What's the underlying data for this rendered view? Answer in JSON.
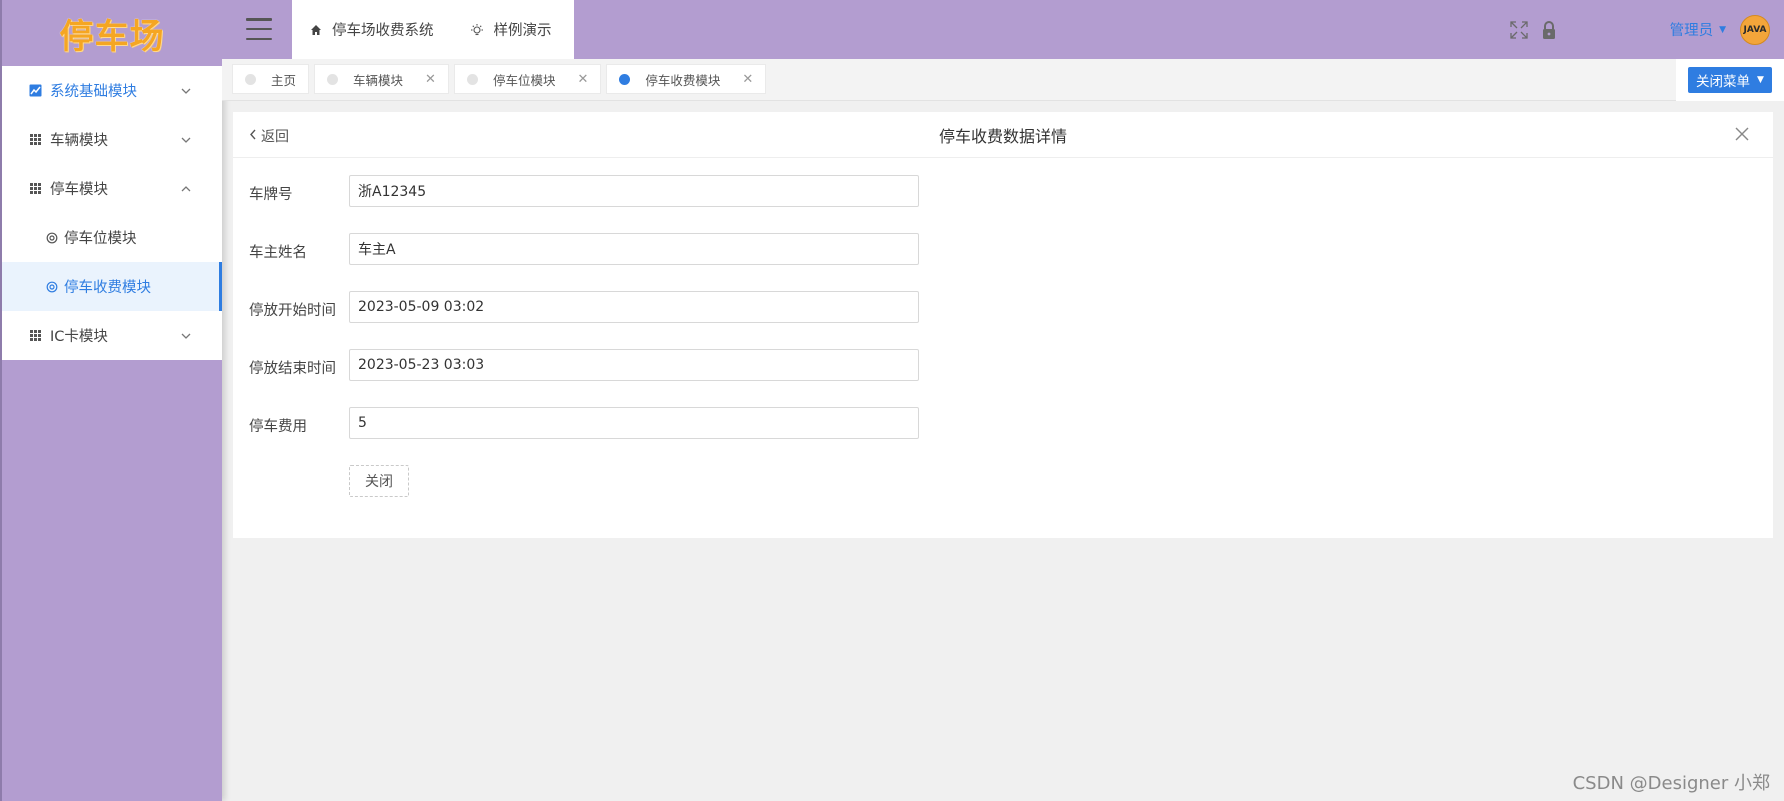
{
  "app": {
    "logo_text": "停车场"
  },
  "sidebar": {
    "items": [
      {
        "label": "系统基础模块",
        "icon": "chart-icon",
        "expanded": false
      },
      {
        "label": "车辆模块",
        "icon": "grid-icon",
        "expanded": false
      },
      {
        "label": "停车模块",
        "icon": "grid-icon",
        "expanded": true,
        "children": [
          {
            "label": "停车位模块",
            "icon": "gear-icon",
            "selected": false
          },
          {
            "label": "停车收费模块",
            "icon": "gear-icon",
            "selected": true
          }
        ]
      },
      {
        "label": "IC卡模块",
        "icon": "grid-icon",
        "expanded": false
      }
    ]
  },
  "header": {
    "nav": [
      {
        "label": "停车场收费系统",
        "icon": "home-icon"
      },
      {
        "label": "样例演示",
        "icon": "bulb-icon"
      }
    ],
    "user_label": "管理员",
    "avatar_text": "JAVA"
  },
  "tabs": [
    {
      "label": "主页",
      "closable": false,
      "active": false
    },
    {
      "label": "车辆模块",
      "closable": true,
      "active": false
    },
    {
      "label": "停车位模块",
      "closable": true,
      "active": false
    },
    {
      "label": "停车收费模块",
      "closable": true,
      "active": true
    }
  ],
  "tabbar": {
    "close_menu_label": "关闭菜单"
  },
  "panel": {
    "back_label": "返回",
    "title": "停车收费数据详情",
    "fields": [
      {
        "label": "车牌号",
        "value": "浙A12345"
      },
      {
        "label": "车主姓名",
        "value": "车主A"
      },
      {
        "label": "停放开始时间",
        "value": "2023-05-09 03:02"
      },
      {
        "label": "停放结束时间",
        "value": "2023-05-23 03:03"
      },
      {
        "label": "停车费用",
        "value": "5"
      }
    ],
    "close_button_label": "关闭"
  },
  "watermark": "CSDN @Designer 小郑",
  "colors": {
    "sidebar_bg": "#b39dd0",
    "accent": "#2f7de1",
    "logo": "#f5a623"
  }
}
